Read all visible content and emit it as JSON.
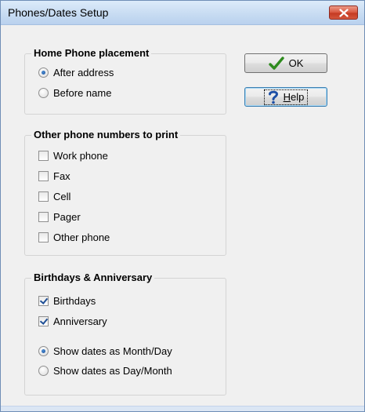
{
  "window": {
    "title": "Phones/Dates Setup"
  },
  "buttons": {
    "ok": "OK",
    "help_prefix": "",
    "help_mnemonic": "H",
    "help_rest": "elp"
  },
  "home_phone": {
    "title": "Home Phone placement",
    "options": [
      {
        "label": "After address",
        "selected": true
      },
      {
        "label": "Before name",
        "selected": false
      }
    ]
  },
  "other_phones": {
    "title": "Other phone numbers to print",
    "items": [
      {
        "label": "Work phone",
        "checked": false
      },
      {
        "label": "Fax",
        "checked": false
      },
      {
        "label": "Cell",
        "checked": false
      },
      {
        "label": "Pager",
        "checked": false
      },
      {
        "label": "Other phone",
        "checked": false
      }
    ]
  },
  "dates": {
    "title": "Birthdays & Anniversary",
    "checks": [
      {
        "label": "Birthdays",
        "checked": true
      },
      {
        "label": "Anniversary",
        "checked": true
      }
    ],
    "formats": [
      {
        "label": "Show dates as Month/Day",
        "selected": true
      },
      {
        "label": "Show dates as Day/Month",
        "selected": false
      }
    ]
  },
  "colors": {
    "ok_check": "#2e8b1e",
    "help_icon": "#1d4fa5",
    "close_bg": "#c94a31"
  },
  "icons": {
    "close": "close-x-icon",
    "ok": "checkmark-icon",
    "help": "question-mark-icon"
  }
}
